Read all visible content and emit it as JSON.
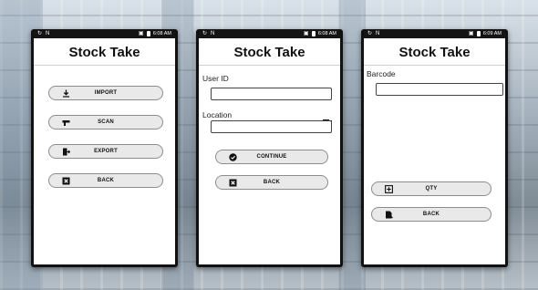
{
  "screens": [
    {
      "status": {
        "time": "6:08 AM"
      },
      "title": "Stock Take",
      "buttons": [
        {
          "label": "IMPORT",
          "icon": "download-icon"
        },
        {
          "label": "SCAN",
          "icon": "scanner-icon"
        },
        {
          "label": "EXPORT",
          "icon": "export-icon"
        },
        {
          "label": "BACK",
          "icon": "close-box-icon"
        }
      ]
    },
    {
      "status": {
        "time": "6:08 AM"
      },
      "title": "Stock Take",
      "fields": [
        {
          "label": "User ID",
          "value": ""
        },
        {
          "label": "Location",
          "value": ""
        }
      ],
      "buttons": [
        {
          "label": "CONTINUE",
          "icon": "check-circle-icon"
        },
        {
          "label": "BACK",
          "icon": "close-box-icon"
        }
      ]
    },
    {
      "status": {
        "time": "6:09 AM"
      },
      "title": "Stock Take",
      "fields": [
        {
          "label": "Barcode",
          "value": ""
        }
      ],
      "buttons": [
        {
          "label": "QTY",
          "icon": "plus-box-icon"
        },
        {
          "label": "BACK",
          "icon": "file-back-icon"
        }
      ]
    }
  ],
  "colors": {
    "status_bar": "#141414",
    "button_bg": "#e9e9e9",
    "button_border": "#8d8d8d",
    "screen_bg": "#ffffff"
  }
}
